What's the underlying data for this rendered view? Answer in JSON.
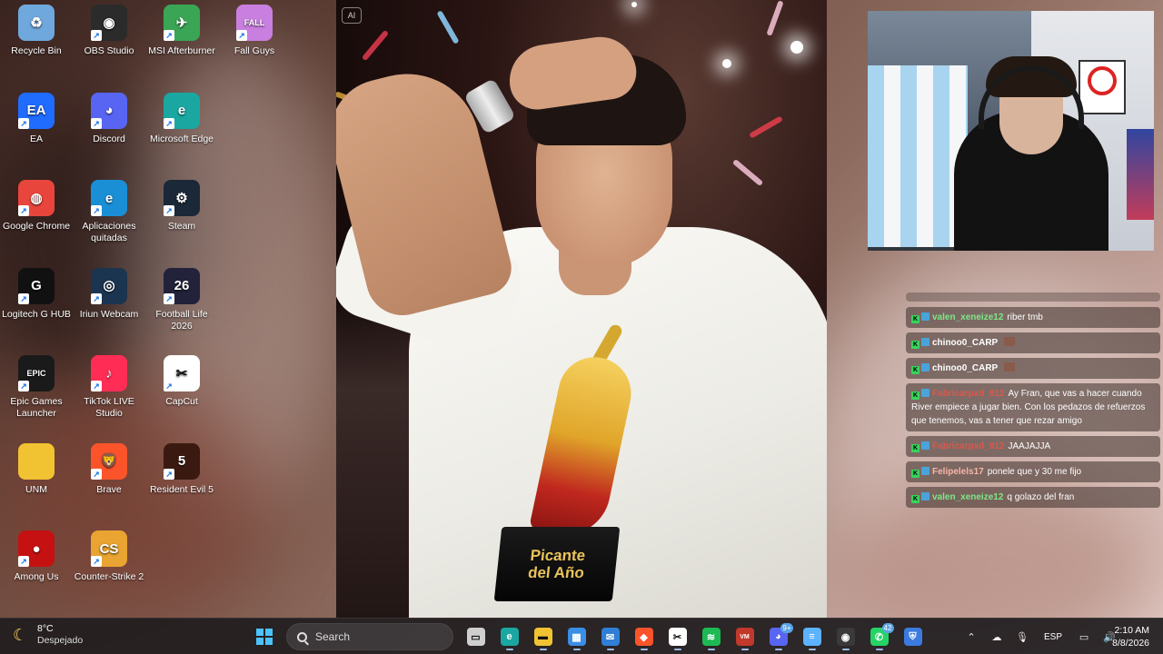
{
  "desktop": {
    "icons": [
      {
        "label": "Recycle Bin",
        "icon": "recycle-bin-icon",
        "color": "#6fa8dc",
        "glyph": "♻"
      },
      {
        "label": "OBS Studio",
        "icon": "obs-icon",
        "color": "#2b2b2b",
        "glyph": "◉"
      },
      {
        "label": "MSI Afterburner",
        "icon": "msi-afterburner-icon",
        "color": "#3aa655",
        "glyph": "✈"
      },
      {
        "label": "Fall Guys",
        "icon": "fall-guys-icon",
        "color": "#c97fe0",
        "glyph": "FALL"
      },
      {
        "label": "EA",
        "icon": "ea-icon",
        "color": "#1f6cff",
        "glyph": "EA"
      },
      {
        "label": "Discord",
        "icon": "discord-icon",
        "color": "#5865f2",
        "glyph": "◕"
      },
      {
        "label": "Microsoft Edge",
        "icon": "edge-icon",
        "color": "#1aa7a1",
        "glyph": "e"
      },
      {
        "label": "Google Chrome",
        "icon": "chrome-icon",
        "color": "#e8453c",
        "glyph": "◍"
      },
      {
        "label": "Aplicaciones quitadas",
        "icon": "edge-icon",
        "color": "#1a8fd6",
        "glyph": "e"
      },
      {
        "label": "Steam",
        "icon": "steam-icon",
        "color": "#1b2838",
        "glyph": "⚙"
      },
      {
        "label": "Logitech G HUB",
        "icon": "logitech-icon",
        "color": "#111111",
        "glyph": "G"
      },
      {
        "label": "Iriun Webcam",
        "icon": "webcam-icon",
        "color": "#1b3550",
        "glyph": "◎"
      },
      {
        "label": "Football Life 2026",
        "icon": "football-life-icon",
        "color": "#22223a",
        "glyph": "26"
      },
      {
        "label": "Epic Games Launcher",
        "icon": "epic-games-icon",
        "color": "#1a1a1a",
        "glyph": "EPIC"
      },
      {
        "label": "TikTok LIVE Studio",
        "icon": "tiktok-icon",
        "color": "#ff2d55",
        "glyph": "♪"
      },
      {
        "label": "CapCut",
        "icon": "capcut-icon",
        "color": "#ffffff",
        "glyph": "✂"
      },
      {
        "label": "UNM",
        "icon": "folder-icon",
        "color": "#f1c232",
        "glyph": ""
      },
      {
        "label": "Brave",
        "icon": "brave-icon",
        "color": "#fb542b",
        "glyph": "🦁"
      },
      {
        "label": "Resident Evil 5",
        "icon": "resident-evil-icon",
        "color": "#3a1a10",
        "glyph": "5"
      },
      {
        "label": "Among Us",
        "icon": "among-us-icon",
        "color": "#c51111",
        "glyph": "●"
      },
      {
        "label": "Counter-Strike 2",
        "icon": "counter-strike-icon",
        "color": "#e9a431",
        "glyph": "CS"
      }
    ]
  },
  "photo": {
    "ai_badge": "AI",
    "trophy_line1": "Picante",
    "trophy_line2": "del Año"
  },
  "chat": {
    "messages": [
      {
        "user": "valen_xeneize12",
        "user_color": "#7ee787",
        "text": "riber tmb",
        "emote": false
      },
      {
        "user": "chinoo0_CARP",
        "user_color": "#ffffff",
        "text": "",
        "emote": true
      },
      {
        "user": "chinoo0_CARP",
        "user_color": "#ffffff",
        "text": "",
        "emote": true
      },
      {
        "user": "Fabricarpxd_912",
        "user_color": "#e0564a",
        "text": "Ay Fran, que vas a hacer cuando River empiece a jugar bien. Con los pedazos de refuerzos que tenemos, vas a tener que rezar amigo",
        "emote": false
      },
      {
        "user": "Fabricarpxd_912",
        "user_color": "#e0564a",
        "text": "JAAJAJJA",
        "emote": false
      },
      {
        "user": "Felipelels17",
        "user_color": "#f5b6a8",
        "text": "ponele que y 30 me fijo",
        "emote": false
      },
      {
        "user": "valen_xeneize12",
        "user_color": "#7ee787",
        "text": "q golazo del fran",
        "emote": false
      }
    ]
  },
  "taskbar": {
    "weather_temp": "8°C",
    "weather_desc": "Despejado",
    "search_placeholder": "Search",
    "apps": [
      {
        "name": "task-view",
        "color": "#cfcfcf",
        "glyph": "▭",
        "badge": ""
      },
      {
        "name": "edge",
        "color": "#1aa7a1",
        "glyph": "e",
        "badge": ""
      },
      {
        "name": "file-explorer",
        "color": "#f1c232",
        "glyph": "▬",
        "badge": ""
      },
      {
        "name": "microsoft-store",
        "color": "#3a8ee6",
        "glyph": "▦",
        "badge": ""
      },
      {
        "name": "mail",
        "color": "#2f7fd6",
        "glyph": "✉",
        "badge": ""
      },
      {
        "name": "brave",
        "color": "#fb542b",
        "glyph": "◆",
        "badge": ""
      },
      {
        "name": "capcut",
        "color": "#ffffff",
        "glyph": "✂",
        "badge": ""
      },
      {
        "name": "spotify",
        "color": "#1db954",
        "glyph": "≋",
        "badge": ""
      },
      {
        "name": "voicemeeter",
        "color": "#c0392b",
        "glyph": "VM",
        "badge": ""
      },
      {
        "name": "discord",
        "color": "#5865f2",
        "glyph": "◕",
        "badge": "9+"
      },
      {
        "name": "notepad",
        "color": "#5cb3ff",
        "glyph": "≡",
        "badge": ""
      },
      {
        "name": "obs",
        "color": "#3a3a3a",
        "glyph": "◉",
        "badge": ""
      },
      {
        "name": "whatsapp",
        "color": "#25d366",
        "glyph": "✆",
        "badge": "42"
      },
      {
        "name": "rocket-league",
        "color": "#3b7be0",
        "glyph": "⛨",
        "badge": ""
      }
    ],
    "lang": "ESP",
    "time": "2:10 AM",
    "date": "8/8/2026"
  }
}
